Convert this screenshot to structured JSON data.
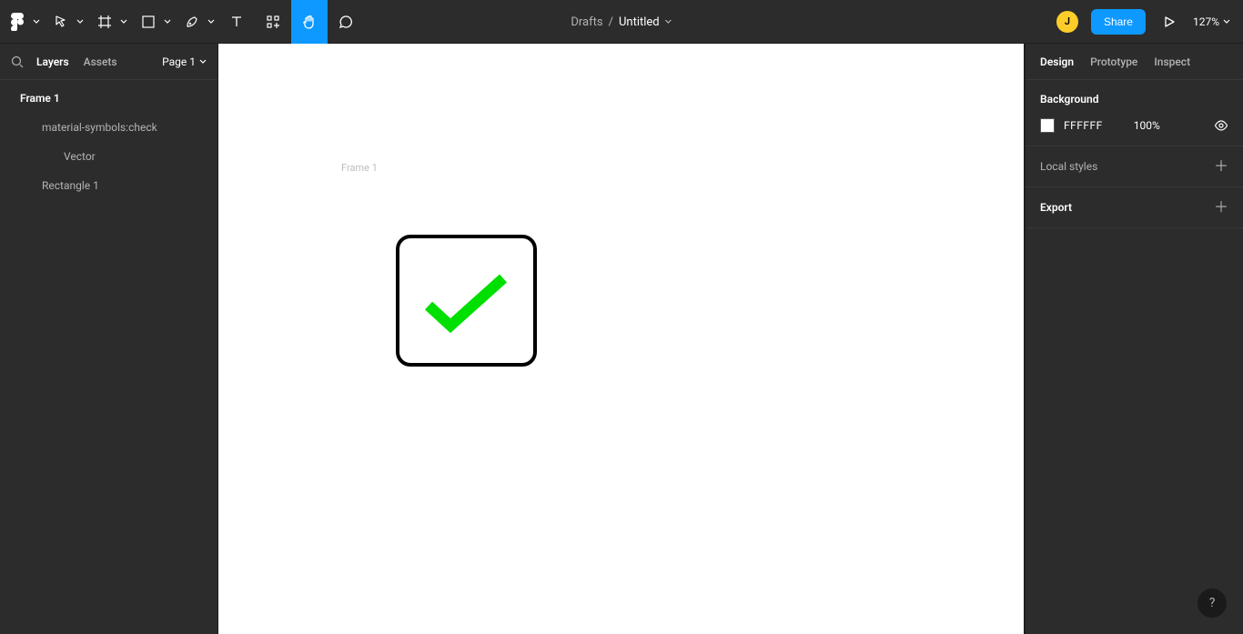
{
  "topbar": {
    "drafts": "Drafts",
    "separator": "/",
    "title": "Untitled",
    "share": "Share",
    "avatar_initial": "J",
    "zoom": "127%"
  },
  "left": {
    "tabs": {
      "layers": "Layers",
      "assets": "Assets"
    },
    "page": "Page 1",
    "layers": [
      {
        "type": "frame",
        "name": "Frame 1",
        "depth": 0,
        "selected": true
      },
      {
        "type": "frame",
        "name": "material-symbols:check",
        "depth": 1,
        "selected": false
      },
      {
        "type": "vector",
        "name": "Vector",
        "depth": 2,
        "selected": false
      },
      {
        "type": "rect",
        "name": "Rectangle 1",
        "depth": 1,
        "selected": false
      }
    ]
  },
  "canvas": {
    "frame_label": "Frame 1"
  },
  "right": {
    "tabs": {
      "design": "Design",
      "prototype": "Prototype",
      "inspect": "Inspect"
    },
    "background": {
      "title": "Background",
      "hex": "FFFFFF",
      "opacity": "100%"
    },
    "local_styles": "Local styles",
    "export": "Export"
  },
  "help": "?"
}
